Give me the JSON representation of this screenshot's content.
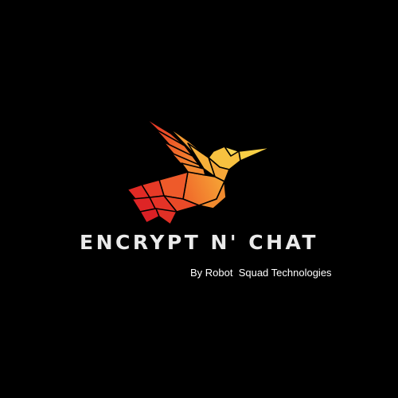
{
  "title": "ENCRYPT N' CHAT",
  "subtitle": "By Robot  Squad Technologies",
  "logo": {
    "icon": "hummingbird-icon"
  },
  "colors": {
    "background": "#000000",
    "title": "#eaeaea",
    "subtitle": "#ffffff",
    "gradient_warm": "#f7c545",
    "gradient_mid": "#f2842a",
    "gradient_hot": "#e0282a"
  }
}
